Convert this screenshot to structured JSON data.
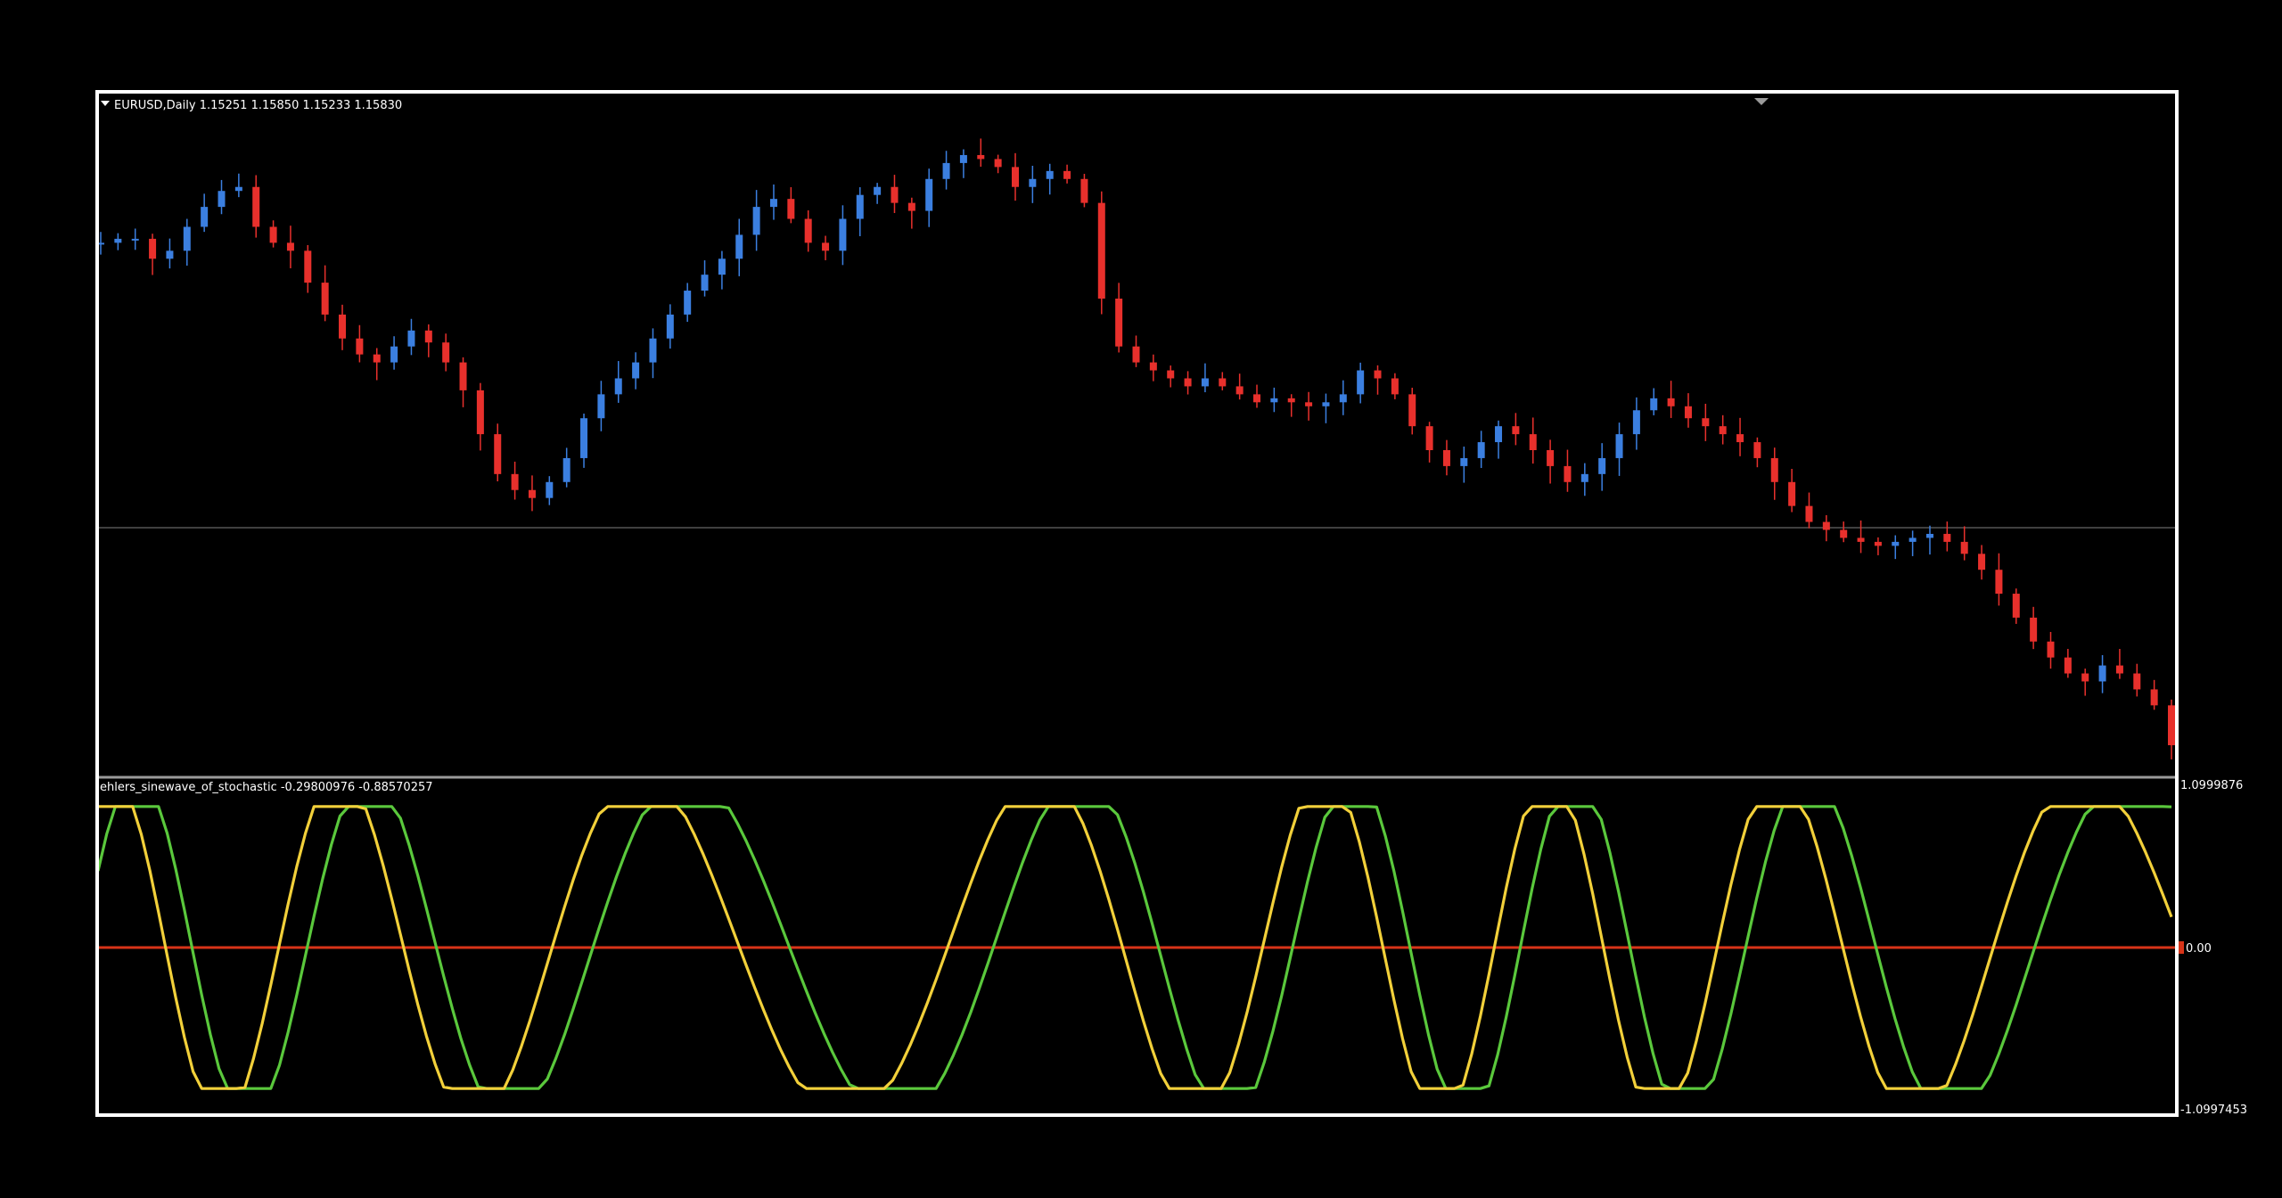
{
  "main": {
    "title": "EURUSD,Daily  1.15251 1.15850 1.15233 1.15830"
  },
  "indicator": {
    "title": "ehlers_sinewave_of_stochastic -0.29800976 -0.88570257",
    "scale_top": "1.0999876",
    "scale_zero": "0.00",
    "scale_bottom": "-1.0997453"
  },
  "colors": {
    "background": "#000000",
    "frame": "#ffffff",
    "bull": "#3b7fe0",
    "bear": "#e8302c",
    "sine": "#f2d03a",
    "lead": "#5ac83c",
    "zero_line": "#d83418",
    "grid": "#555555"
  },
  "chart_data": [
    {
      "type": "candlestick",
      "symbol": "EURUSD",
      "timeframe": "Daily",
      "last_ohlc": {
        "open": 1.15251,
        "high": 1.1585,
        "low": 1.15233,
        "close": 1.1583
      },
      "close_path": [
        0.96,
        0.97,
        0.97,
        0.92,
        0.94,
        1.0,
        1.05,
        1.09,
        1.1,
        1.0,
        0.96,
        0.94,
        0.86,
        0.78,
        0.72,
        0.68,
        0.66,
        0.7,
        0.74,
        0.71,
        0.66,
        0.59,
        0.48,
        0.38,
        0.34,
        0.32,
        0.36,
        0.42,
        0.52,
        0.58,
        0.62,
        0.66,
        0.72,
        0.78,
        0.84,
        0.88,
        0.92,
        0.98,
        1.05,
        1.07,
        1.02,
        0.96,
        0.94,
        1.02,
        1.08,
        1.1,
        1.06,
        1.04,
        1.12,
        1.16,
        1.18,
        1.17,
        1.15,
        1.1,
        1.12,
        1.14,
        1.12,
        1.06,
        0.82,
        0.7,
        0.66,
        0.64,
        0.62,
        0.6,
        0.62,
        0.6,
        0.58,
        0.56,
        0.57,
        0.56,
        0.55,
        0.56,
        0.58,
        0.64,
        0.62,
        0.58,
        0.5,
        0.44,
        0.4,
        0.42,
        0.46,
        0.5,
        0.48,
        0.44,
        0.4,
        0.36,
        0.38,
        0.42,
        0.48,
        0.54,
        0.57,
        0.55,
        0.52,
        0.5,
        0.48,
        0.46,
        0.42,
        0.36,
        0.3,
        0.26,
        0.24,
        0.22,
        0.21,
        0.2,
        0.21,
        0.22,
        0.23,
        0.21,
        0.18,
        0.14,
        0.08,
        0.02,
        -0.04,
        -0.08,
        -0.12,
        -0.14,
        -0.1,
        -0.12,
        -0.16,
        -0.2,
        -0.3
      ]
    },
    {
      "type": "line",
      "title": "ehlers_sinewave_of_stochastic",
      "ylim": [
        -1.0997453,
        1.0999876
      ],
      "zero_line": 0.0,
      "series": [
        {
          "color": "#f2d03a",
          "last": -0.29800976
        },
        {
          "color": "#5ac83c",
          "last": -0.88570257
        }
      ]
    }
  ]
}
